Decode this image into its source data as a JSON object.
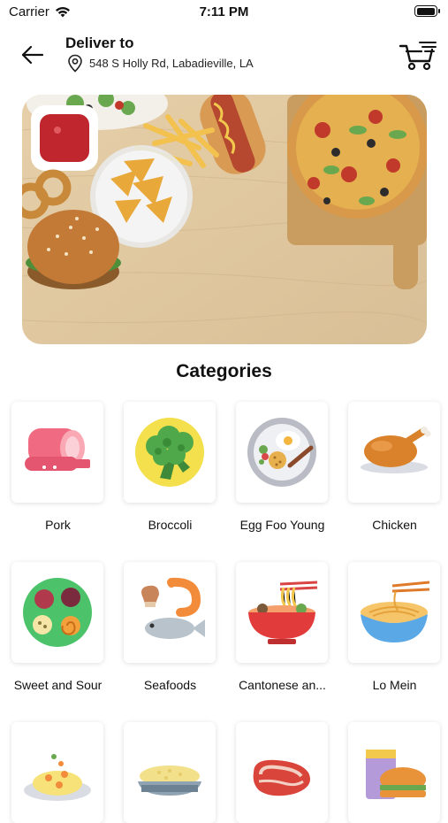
{
  "status_bar": {
    "carrier": "Carrier",
    "time": "7:11 PM",
    "battery_level": 1.0
  },
  "header": {
    "title": "Deliver to",
    "address": "548 S Holly Rd, Labadieville, LA",
    "icons": {
      "back": "arrow-left-icon",
      "location": "location-pin-icon",
      "cart": "shopping-cart-icon"
    }
  },
  "banner": {
    "image": "food-banner-pizza-burger-fries"
  },
  "section_title": "Categories",
  "categories": [
    {
      "label": "Pork",
      "icon": "ham-icon"
    },
    {
      "label": "Broccoli",
      "icon": "broccoli-icon"
    },
    {
      "label": "Egg Foo Young",
      "icon": "egg-plate-icon"
    },
    {
      "label": "Chicken",
      "icon": "roast-chicken-icon"
    },
    {
      "label": "Sweet and Sour",
      "icon": "dip-platter-icon"
    },
    {
      "label": "Seafoods",
      "icon": "seafood-icon"
    },
    {
      "label": "Cantonese an...",
      "icon": "noodle-bowl-icon"
    },
    {
      "label": "Lo Mein",
      "icon": "lo-mein-icon"
    },
    {
      "label": "",
      "icon": "shrimp-rice-icon"
    },
    {
      "label": "",
      "icon": "rice-bowl-icon"
    },
    {
      "label": "",
      "icon": "steak-icon"
    },
    {
      "label": "",
      "icon": "burger-drink-icon"
    }
  ]
}
